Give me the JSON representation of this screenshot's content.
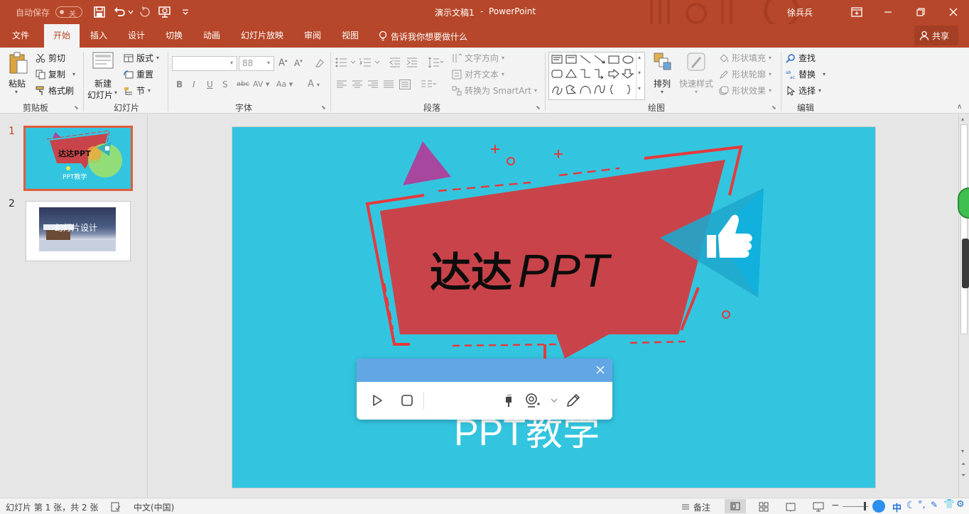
{
  "title_bar": {
    "autosave_label": "自动保存",
    "autosave_state": "关",
    "document_title": "演示文稿1",
    "title_sep": "-",
    "app_name": "PowerPoint",
    "user_name": "徐兵兵"
  },
  "tabs": [
    {
      "label": "文件",
      "active": false
    },
    {
      "label": "开始",
      "active": true
    },
    {
      "label": "插入",
      "active": false
    },
    {
      "label": "设计",
      "active": false
    },
    {
      "label": "切换",
      "active": false
    },
    {
      "label": "动画",
      "active": false
    },
    {
      "label": "幻灯片放映",
      "active": false
    },
    {
      "label": "审阅",
      "active": false
    },
    {
      "label": "视图",
      "active": false
    }
  ],
  "tell_me": "告诉我你想要做什么",
  "share_label": "共享",
  "ribbon": {
    "clipboard": {
      "paste": "粘贴",
      "cut": "剪切",
      "copy": "复制",
      "format_painter": "格式刷",
      "group": "剪贴板"
    },
    "slides": {
      "new_slide_line1": "新建",
      "new_slide_line2": "幻灯片",
      "layout": "版式",
      "reset": "重置",
      "section": "节",
      "group": "幻灯片"
    },
    "font": {
      "font_name": "",
      "font_size": "88",
      "group": "字体"
    },
    "paragraph": {
      "text_direction": "文字方向",
      "align_text": "对齐文本",
      "convert_smartart": "转换为 SmartArt",
      "group": "段落"
    },
    "drawing": {
      "arrange": "排列",
      "quick_styles": "快速样式",
      "shape_fill": "形状填充",
      "shape_outline": "形状轮廓",
      "shape_effects": "形状效果",
      "group": "绘图"
    },
    "editing": {
      "find": "查找",
      "replace": "替换",
      "select": "选择",
      "group": "编辑"
    }
  },
  "thumbnails": [
    {
      "number": "1",
      "title": "达达PPT",
      "subtitle": "PPT教学",
      "selected": true
    },
    {
      "number": "2",
      "title": "幻灯片设计",
      "selected": false
    }
  ],
  "slide": {
    "title_cn": "达达",
    "title_en": "PPT",
    "subtitle": "PPT教学",
    "background_color": "#33c5df",
    "banner_color": "#c9444a",
    "triangle_color": "#a8479e"
  },
  "status_bar": {
    "slide_info": "幻灯片 第 1 张，共 2 张",
    "language": "中文(中国)",
    "notes": "备注",
    "ime_label": "中"
  },
  "colors": {
    "accent": "#b7472a",
    "ribbon_bg": "#f3f3f3",
    "toolbar_head": "#62a6e4"
  }
}
